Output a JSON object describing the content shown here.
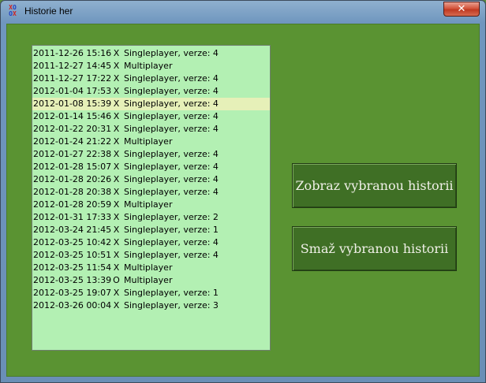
{
  "window": {
    "title": "Historie her",
    "close_label": "✕"
  },
  "app_icon": {
    "row1": "XO",
    "row2": "OX",
    "colors": {
      "x": "#d02020",
      "o": "#2040c0"
    }
  },
  "history": {
    "items": [
      {
        "datetime": "2011-12-26 15:16",
        "player": "X",
        "mode": "Singleplayer, verze: 4"
      },
      {
        "datetime": "2011-12-27 14:45",
        "player": "X",
        "mode": "Multiplayer"
      },
      {
        "datetime": "2011-12-27 17:22",
        "player": "X",
        "mode": "Singleplayer, verze: 4"
      },
      {
        "datetime": "2012-01-04 17:53",
        "player": "X",
        "mode": "Singleplayer, verze: 4"
      },
      {
        "datetime": "2012-01-08 15:39",
        "player": "X",
        "mode": "Singleplayer, verze: 4",
        "selected": true
      },
      {
        "datetime": "2012-01-14 15:46",
        "player": "X",
        "mode": "Singleplayer, verze: 4"
      },
      {
        "datetime": "2012-01-22 20:31",
        "player": "X",
        "mode": "Singleplayer, verze: 4"
      },
      {
        "datetime": "2012-01-24 21:22",
        "player": "X",
        "mode": "Multiplayer"
      },
      {
        "datetime": "2012-01-27 22:38",
        "player": "X",
        "mode": "Singleplayer, verze: 4"
      },
      {
        "datetime": "2012-01-28 15:07",
        "player": "X",
        "mode": "Singleplayer, verze: 4"
      },
      {
        "datetime": "2012-01-28 20:26",
        "player": "X",
        "mode": "Singleplayer, verze: 4"
      },
      {
        "datetime": "2012-01-28 20:38",
        "player": "X",
        "mode": "Singleplayer, verze: 4"
      },
      {
        "datetime": "2012-01-28 20:59",
        "player": "X",
        "mode": "Multiplayer"
      },
      {
        "datetime": "2012-01-31 17:33",
        "player": "X",
        "mode": "Singleplayer, verze: 2"
      },
      {
        "datetime": "2012-03-24 21:45",
        "player": "X",
        "mode": "Singleplayer, verze: 1"
      },
      {
        "datetime": "2012-03-25 10:42",
        "player": "X",
        "mode": "Singleplayer, verze: 4"
      },
      {
        "datetime": "2012-03-25 10:51",
        "player": "X",
        "mode": "Singleplayer, verze: 4"
      },
      {
        "datetime": "2012-03-25 11:54",
        "player": "X",
        "mode": "Multiplayer"
      },
      {
        "datetime": "2012-03-25 13:39",
        "player": "O",
        "mode": "Multiplayer"
      },
      {
        "datetime": "2012-03-25 19:07",
        "player": "X",
        "mode": "Singleplayer, verze: 1"
      },
      {
        "datetime": "2012-03-26 00:04",
        "player": "X",
        "mode": "Singleplayer, verze: 3"
      }
    ]
  },
  "buttons": {
    "show_label": "Zobraz vybranou historii",
    "delete_label": "Smaž vybranou historii"
  }
}
